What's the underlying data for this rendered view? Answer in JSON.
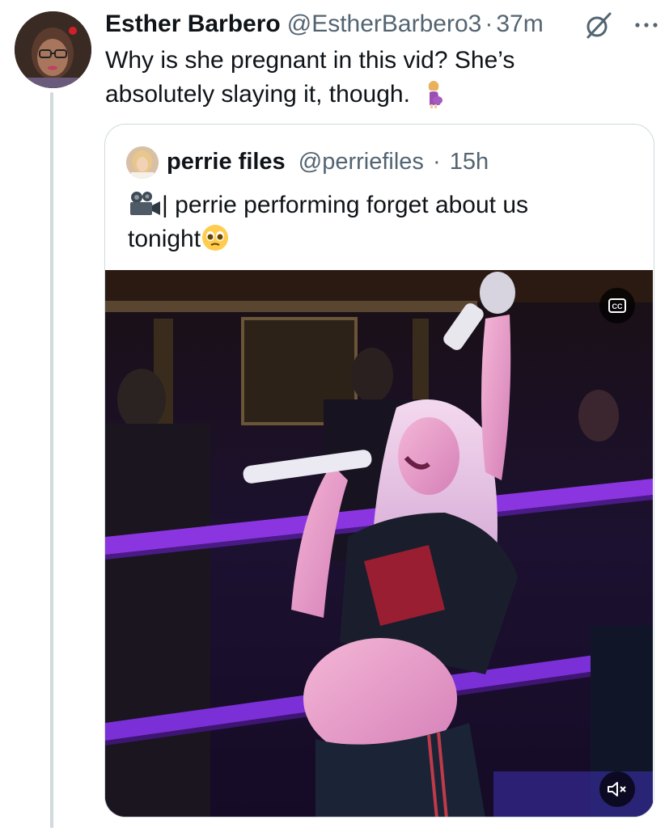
{
  "tweet": {
    "author": {
      "name": "Esther Barbero",
      "handle": "@EstherBarbero3",
      "separator": "·",
      "time": "37m"
    },
    "text": "Why is she pregnant in this vid? She’s absolutely slaying it, though.",
    "text_emoji": "pregnant-woman-emoji",
    "header_icons": [
      "grok-icon",
      "more-icon"
    ]
  },
  "quote": {
    "author": {
      "name": "perrie files",
      "handle": "@perriefiles",
      "separator": "·",
      "time": "15h"
    },
    "text_line1": "| perrie performing forget about us",
    "text_line2": "tonight",
    "leading_emoji": "movie-camera-emoji",
    "trailing_emoji": "pleading-face-emoji",
    "media": {
      "type": "video",
      "cc_label": "CC",
      "mute_icon": "speaker-muted-icon"
    }
  },
  "colors": {
    "text_primary": "#0f1419",
    "text_secondary": "#536471",
    "border": "#cfd9de",
    "stage_purple": "#7b2fd6"
  }
}
